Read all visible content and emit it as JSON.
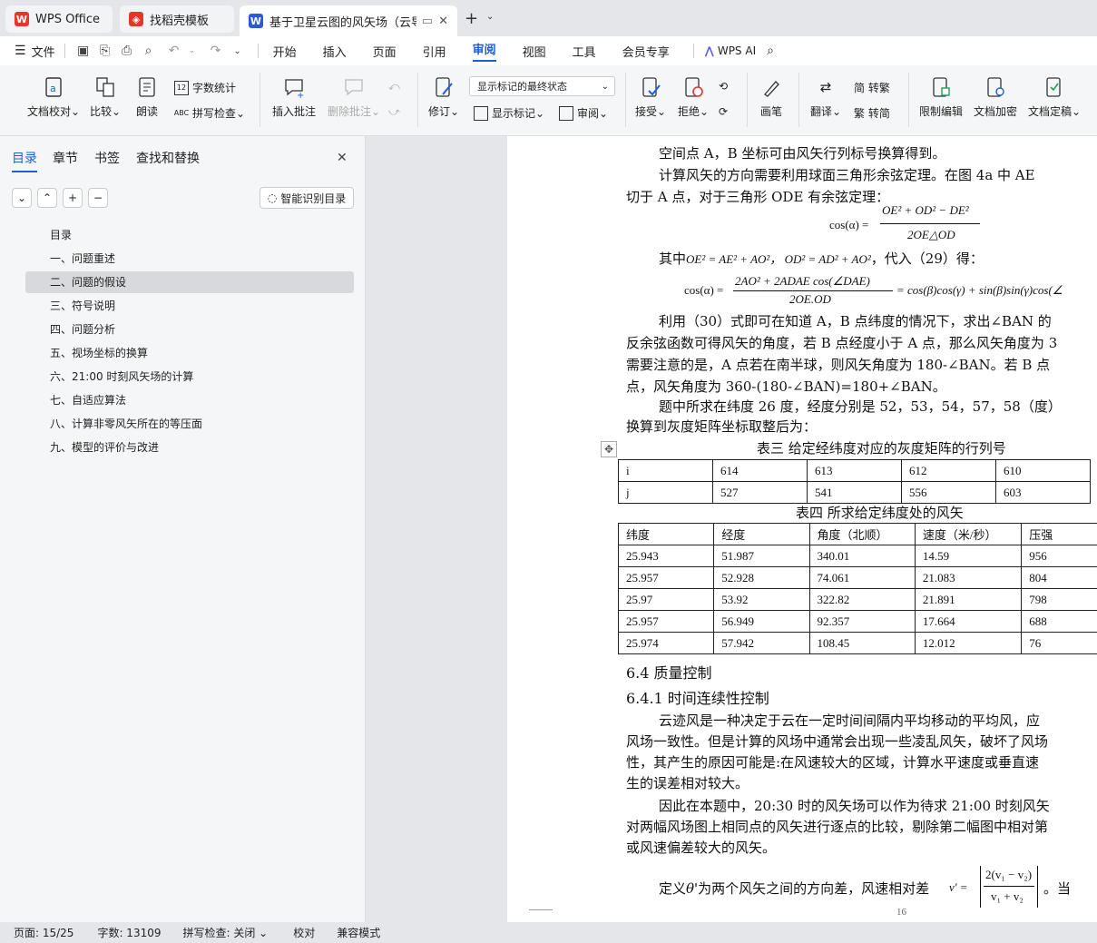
{
  "tabs": {
    "wps": "WPS Office",
    "template": "找稻壳模板",
    "doc": "基于卫星云图的风矢场（云导风"
  },
  "menu": {
    "file": "文件",
    "items": [
      "开始",
      "插入",
      "页面",
      "引用",
      "审阅",
      "视图",
      "工具",
      "会员专享"
    ],
    "active": "审阅",
    "ai": "WPS AI"
  },
  "ribbon": {
    "doc_proof": "文档校对",
    "compare": "比较",
    "read_aloud": "朗读",
    "word_count": "字数统计",
    "spell_check": "拼写检查",
    "insert_comment": "插入批注",
    "delete_comment": "删除批注",
    "revise": "修订",
    "markup_state": "显示标记的最终状态",
    "show_markup": "显示标记",
    "review_pane": "审阅",
    "accept": "接受",
    "reject": "拒绝",
    "pen": "画笔",
    "translate": "翻译",
    "to_traditional": "简 转繁",
    "to_simplified": "繁 转简",
    "restrict": "限制编辑",
    "encrypt": "文档加密",
    "finalize": "文档定稿"
  },
  "sidebar": {
    "tabs": [
      "目录",
      "章节",
      "书签",
      "查找和替换"
    ],
    "smart_toc": "智能识别目录",
    "toc": [
      "目录",
      "一、问题重述",
      "二、问题的假设",
      "三、符号说明",
      "四、问题分析",
      "五、视场坐标的换算",
      "六、21:00 时刻风矢场的计算",
      "七、自适应算法",
      "八、计算非零风矢所在的等压面",
      "九、模型的评价与改进"
    ],
    "selected_index": 2
  },
  "doc": {
    "l1": "空间点 A，B 坐标可由风矢行列标号换算得到。",
    "l2": "计算风矢的方向需要利用球面三角形余弦定理。在图 4a 中 AE",
    "l3": "切于 A 点，对于三角形 ODE 有余弦定理：",
    "eq1_lhs": "cos(α) =",
    "eq1_num": "OE² + OD² − DE²",
    "eq1_den": "2OE△OD",
    "l4_a": "其中",
    "l4_eq": "OE² = AE² + AO²，  OD² = AD² + AO²",
    "l4_b": "，代入（29）得：",
    "eq2_lhs": "cos(α) =",
    "eq2_num": "2AO² + 2ADAE cos(∠DAE)",
    "eq2_den": "2OE.OD",
    "eq2_rhs": "= cos(β)cos(γ) + sin(β)sin(γ)cos(∠",
    "l5": "利用（30）式即可在知道 A，B 点纬度的情况下，求出∠BAN 的",
    "l6": "反余弦函数可得风矢的角度，若 B 点经度小于 A 点，那么风矢角度为 3",
    "l7": "需要注意的是，A 点若在南半球，则风矢角度为 180-∠BAN。若 B 点",
    "l8": "点，风矢角度为 360-(180-∠BAN)=180+∠BAN。",
    "l9": "题中所求在纬度 26 度，经度分别是 52，53，54，57，58（度）",
    "l10": "换算到灰度矩阵坐标取整后为：",
    "table3_caption": "表三  给定经纬度对应的灰度矩阵的行列号",
    "table3": [
      [
        "i",
        "614",
        "613",
        "612",
        "610"
      ],
      [
        "j",
        "527",
        "541",
        "556",
        "603"
      ]
    ],
    "table4_caption": "表四  所求给定纬度处的风矢",
    "table4_header": [
      "纬度",
      "经度",
      "角度（北顺）",
      "速度（米/秒）",
      "压强"
    ],
    "table4_rows": [
      [
        "25.943",
        "51.987",
        "340.01",
        "14.59",
        "956"
      ],
      [
        "25.957",
        "52.928",
        "74.061",
        "21.083",
        "804"
      ],
      [
        "25.97",
        "53.92",
        "322.82",
        "21.891",
        "798"
      ],
      [
        "25.957",
        "56.949",
        "92.357",
        "17.664",
        "688"
      ],
      [
        "25.974",
        "57.942",
        "108.45",
        "12.012",
        "76"
      ]
    ],
    "h1": "6.4 质量控制",
    "h2": "6.4.1 时间连续性控制",
    "p1": "云迹风是一种决定于云在一定时间间隔内平均移动的平均风，应",
    "p2": "风场一致性。但是计算的风场中通常会出现一些凌乱风矢，破坏了风场",
    "p3": "性，其产生的原因可能是:在风速较大的区域，计算水平速度或垂直速",
    "p4": "生的误差相对较大。",
    "p5": "因此在本题中，20:30 时的风矢场可以作为待求 21:00 时刻风矢",
    "p6": "对两幅风场图上相同点的风矢进行逐点的比较，剔除第二幅图中相对第",
    "p7": "或风速偏差较大的风矢。",
    "p8_a": "定义",
    "p8_theta": "θ'",
    "p8_b": "为两个风矢之间的方向差，风速相对差",
    "p8_v": "v' =",
    "p8_num": "2(v₁ − v₂)",
    "p8_den": "v₁ + v₂",
    "p8_c": "。当",
    "page_number": "16"
  },
  "status": {
    "page": "页面: 15/25",
    "words": "字数: 13109",
    "spell": "拼写检查: 关闭",
    "proof": "校对",
    "compat": "兼容模式"
  },
  "colors": {
    "accent": "#1f5fd6",
    "wps_red": "#e8352c",
    "doc_blue": "#2b5ad8"
  }
}
